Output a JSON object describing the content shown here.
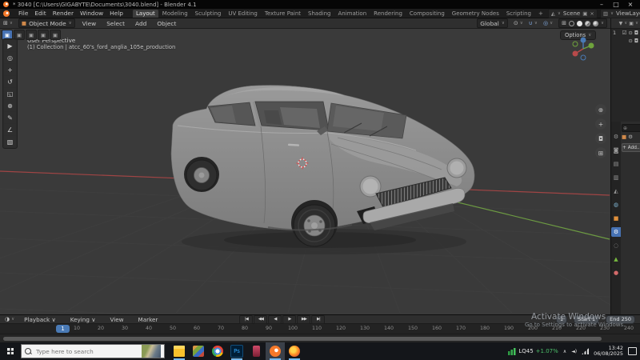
{
  "window": {
    "title": "* 3040 [C:\\Users\\GIGABYTE\\Documents\\3040.blend] - Blender 4.1",
    "controls": {
      "minimize": "–",
      "maximize": "□",
      "close": "×"
    }
  },
  "icons": {
    "chevron": "∨",
    "copy": "▣",
    "close": "×",
    "scene": "◭",
    "layers": "▥",
    "editor": "⊞",
    "object": "■",
    "clock": "◑",
    "filter": "▼",
    "search": "⊕",
    "eye": "⊙",
    "camera": "◘",
    "checkbox": "☑",
    "magnet": "∪",
    "pivot": "⊙",
    "overlay": "◎",
    "xray": "⊞",
    "wrench": "⚙",
    "tool_mode": "▣",
    "hidden_tray": "∧",
    "speaker": "◄)",
    "collection_arrow": "▸"
  },
  "topbar": {
    "menus": [
      "File",
      "Edit",
      "Render",
      "Window",
      "Help"
    ],
    "workspaces": [
      "Layout",
      "Modeling",
      "Sculpting",
      "UV Editing",
      "Texture Paint",
      "Shading",
      "Animation",
      "Rendering",
      "Compositing",
      "Geometry Nodes",
      "Scripting",
      "+"
    ],
    "active_workspace": "Layout",
    "scene": "Scene",
    "view_layer": "ViewLayer"
  },
  "viewport": {
    "header": {
      "mode": "Object Mode",
      "menus": [
        "View",
        "Select",
        "Add",
        "Object"
      ],
      "orientation": "Global",
      "options_label": "Options"
    },
    "overlay": {
      "line1": "User Perspective",
      "line2": "(1) Collection | atcc_60's_ford_anglia_105e_production"
    },
    "tools": [
      {
        "name": "select-box-tool",
        "glyph": "▶"
      },
      {
        "name": "cursor-tool",
        "glyph": "◎"
      },
      {
        "name": "move-tool",
        "glyph": "+"
      },
      {
        "name": "rotate-tool",
        "glyph": "↺"
      },
      {
        "name": "scale-tool",
        "glyph": "◱"
      },
      {
        "name": "transform-tool",
        "glyph": "⊕"
      },
      {
        "name": "annotate-tool",
        "glyph": "✎"
      },
      {
        "name": "measure-tool",
        "glyph": "∠"
      },
      {
        "name": "add-cube-tool",
        "glyph": "▧"
      }
    ],
    "nav_buttons": [
      {
        "name": "zoom-view",
        "glyph": "⊕"
      },
      {
        "name": "pan-view",
        "glyph": "+"
      },
      {
        "name": "camera-view",
        "glyph": "◘"
      },
      {
        "name": "toggle-ortho",
        "glyph": "⊞"
      }
    ]
  },
  "outliner": {
    "rows": [
      {
        "label": "1"
      },
      {
        "label": ""
      }
    ]
  },
  "properties": {
    "add_label": "+ Add...",
    "tabs": [
      {
        "name": "tool",
        "glyph": "⚙"
      },
      {
        "name": "render",
        "glyph": "◙"
      },
      {
        "name": "output",
        "glyph": "▤"
      },
      {
        "name": "view-layer",
        "glyph": "▥"
      },
      {
        "name": "scene",
        "glyph": "◭"
      },
      {
        "name": "world",
        "glyph": "◍"
      },
      {
        "name": "object",
        "glyph": "■"
      },
      {
        "name": "modifiers",
        "glyph": "⚙",
        "active": true
      },
      {
        "name": "physics",
        "glyph": "◌"
      },
      {
        "name": "data",
        "glyph": "▲"
      },
      {
        "name": "material",
        "glyph": "●"
      }
    ]
  },
  "timeline": {
    "menus": [
      "Playback ∨",
      "Keying ∨",
      "View",
      "Marker"
    ],
    "transport": [
      {
        "name": "jump-to-start",
        "glyph": "|◀"
      },
      {
        "name": "prev-keyframe",
        "glyph": "◀◀"
      },
      {
        "name": "play-reverse",
        "glyph": "◀"
      },
      {
        "name": "play",
        "glyph": "▶"
      },
      {
        "name": "next-keyframe",
        "glyph": "▶▶"
      },
      {
        "name": "jump-to-end",
        "glyph": "▶|"
      }
    ],
    "current_frame": "1",
    "start_field": "Start 1",
    "end_field": "End 250",
    "ticks": [
      "10",
      "20",
      "30",
      "40",
      "50",
      "60",
      "70",
      "80",
      "90",
      "100",
      "110",
      "120",
      "130",
      "140",
      "150",
      "160",
      "170",
      "180",
      "190",
      "200",
      "210",
      "220",
      "230",
      "240"
    ]
  },
  "watermark": {
    "line1": "Activate Windows",
    "line2": "Go to Settings to activate Windows."
  },
  "taskbar": {
    "search_placeholder": "Type here to search",
    "apps": [
      {
        "name": "file-explorer",
        "open": true
      },
      {
        "name": "photos",
        "open": false
      },
      {
        "name": "chrome",
        "open": false
      },
      {
        "name": "photoshop",
        "open": true,
        "text": "Ps"
      },
      {
        "name": "media",
        "open": false
      },
      {
        "name": "blender",
        "open": true,
        "active": true
      },
      {
        "name": "firefox",
        "open": true
      }
    ],
    "tray": {
      "ticker_symbol": "LQ45",
      "ticker_change": "+1.07%",
      "time": "13:42",
      "date": "06/08/2025"
    }
  },
  "colors": {
    "accent_blue": "#4772b3",
    "axis_x_red": "#a04545",
    "axis_y_green": "#6d9b43",
    "ticker_green": "#4cc06a",
    "viewport_bg": "#3a3a3a"
  }
}
